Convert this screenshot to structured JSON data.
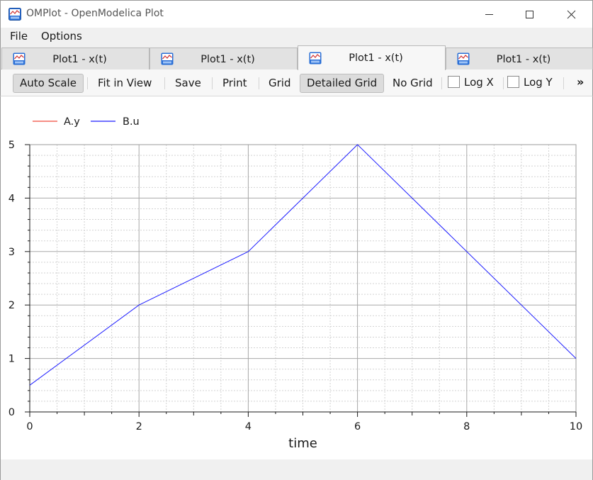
{
  "window": {
    "title": "OMPlot - OpenModelica Plot",
    "icon": "openmodelica-plot-icon"
  },
  "menu": {
    "file": "File",
    "options": "Options"
  },
  "tabs": [
    {
      "label": "Plot1 - x(t)",
      "active": false
    },
    {
      "label": "Plot1 - x(t)",
      "active": false
    },
    {
      "label": "Plot1 - x(t)",
      "active": true
    },
    {
      "label": "Plot1 - x(t)",
      "active": false
    }
  ],
  "toolbar": {
    "auto_scale": "Auto Scale",
    "fit_in_view": "Fit in View",
    "save": "Save",
    "print": "Print",
    "grid": "Grid",
    "detailed_grid": "Detailed Grid",
    "no_grid": "No Grid",
    "log_x": "Log X",
    "log_y": "Log Y",
    "log_x_checked": false,
    "log_y_checked": false,
    "more": "»"
  },
  "chart_data": {
    "type": "line",
    "xlabel": "time",
    "ylabel": "",
    "xlim": [
      0,
      10
    ],
    "ylim": [
      0,
      5
    ],
    "xticks": [
      0,
      2,
      4,
      6,
      8,
      10
    ],
    "yticks": [
      0,
      1,
      2,
      3,
      4,
      5
    ],
    "grid": "detailed",
    "legend_position": "top-left",
    "series": [
      {
        "name": "A.y",
        "color": "#f04a3c",
        "x": [],
        "y": []
      },
      {
        "name": "B.u",
        "color": "#1f1fff",
        "x": [
          0,
          2,
          4,
          6,
          10
        ],
        "y": [
          0.5,
          2,
          3,
          5,
          1
        ]
      }
    ]
  }
}
